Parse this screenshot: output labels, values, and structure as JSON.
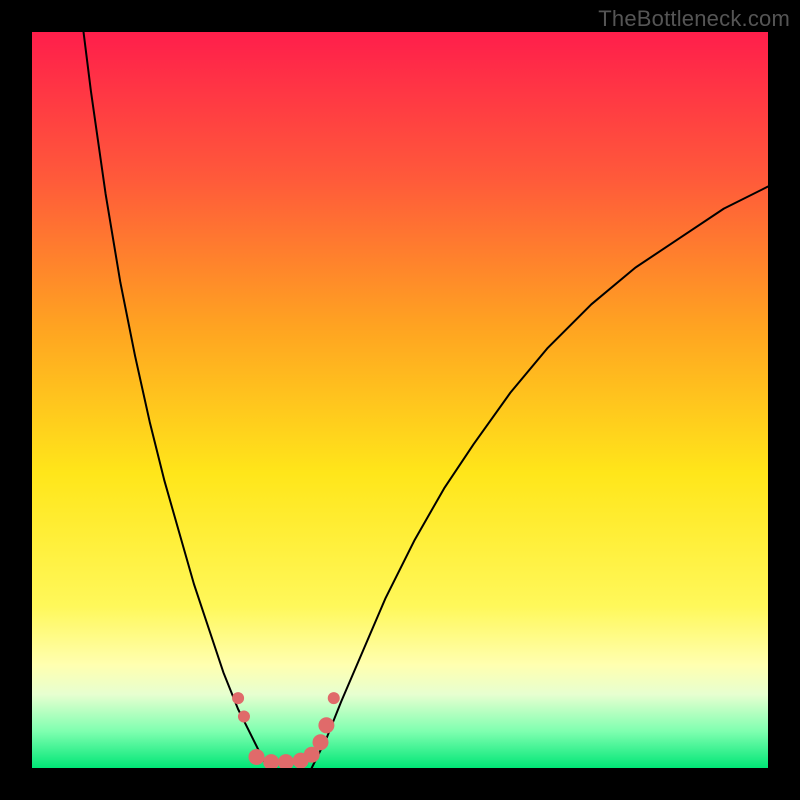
{
  "watermark": "TheBottleneck.com",
  "chart_data": {
    "type": "line",
    "title": "",
    "xlabel": "",
    "ylabel": "",
    "xlim": [
      0,
      100
    ],
    "ylim": [
      0,
      100
    ],
    "grid": false,
    "legend": false,
    "background_gradient_stops": [
      {
        "offset": 0.0,
        "color": "#ff1e4b"
      },
      {
        "offset": 0.2,
        "color": "#ff5a3a"
      },
      {
        "offset": 0.4,
        "color": "#ffa321"
      },
      {
        "offset": 0.6,
        "color": "#ffe61a"
      },
      {
        "offset": 0.78,
        "color": "#fff85a"
      },
      {
        "offset": 0.86,
        "color": "#ffffb0"
      },
      {
        "offset": 0.9,
        "color": "#e7ffd0"
      },
      {
        "offset": 0.95,
        "color": "#7fffb0"
      },
      {
        "offset": 1.0,
        "color": "#00e676"
      }
    ],
    "series": [
      {
        "name": "curve-left",
        "color": "#000000",
        "width": 2,
        "x": [
          7,
          8,
          9,
          10,
          12,
          14,
          16,
          18,
          20,
          22,
          24,
          26,
          28,
          29,
          30,
          31,
          32
        ],
        "y": [
          100,
          92,
          85,
          78,
          66,
          56,
          47,
          39,
          32,
          25,
          19,
          13,
          8,
          6,
          4,
          2,
          0
        ]
      },
      {
        "name": "curve-right",
        "color": "#000000",
        "width": 2,
        "x": [
          38,
          40,
          42,
          45,
          48,
          52,
          56,
          60,
          65,
          70,
          76,
          82,
          88,
          94,
          100
        ],
        "y": [
          0,
          4,
          9,
          16,
          23,
          31,
          38,
          44,
          51,
          57,
          63,
          68,
          72,
          76,
          79
        ]
      }
    ],
    "markers": {
      "name": "bottom-dots",
      "color": "#e06a6a",
      "radius_small": 6,
      "radius_large": 8,
      "points": [
        {
          "x": 28.0,
          "y": 9.5,
          "r": "small"
        },
        {
          "x": 28.8,
          "y": 7.0,
          "r": "small"
        },
        {
          "x": 30.5,
          "y": 1.5,
          "r": "large"
        },
        {
          "x": 32.5,
          "y": 0.8,
          "r": "large"
        },
        {
          "x": 34.5,
          "y": 0.8,
          "r": "large"
        },
        {
          "x": 36.5,
          "y": 1.0,
          "r": "large"
        },
        {
          "x": 38.0,
          "y": 1.8,
          "r": "large"
        },
        {
          "x": 39.2,
          "y": 3.5,
          "r": "large"
        },
        {
          "x": 40.0,
          "y": 5.8,
          "r": "large"
        },
        {
          "x": 41.0,
          "y": 9.5,
          "r": "small"
        }
      ]
    }
  }
}
